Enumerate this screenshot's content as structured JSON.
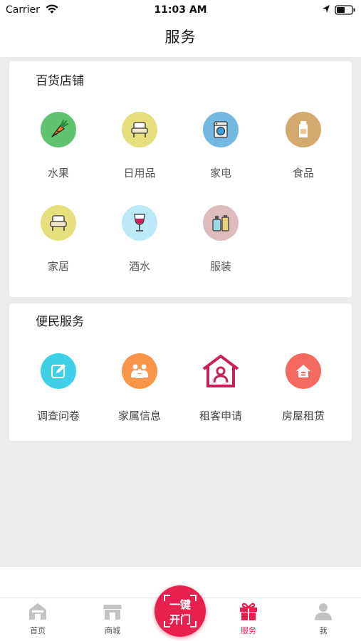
{
  "status_bar": {
    "carrier": "Carrier",
    "time": "11:03 AM"
  },
  "nav": {
    "title": "服务"
  },
  "department_store": {
    "title": "百货店铺",
    "items": [
      {
        "label": "水果",
        "icon": "carrot-icon",
        "color": "#5fc36f"
      },
      {
        "label": "日用品",
        "icon": "armchair-icon",
        "color": "#e5df7e"
      },
      {
        "label": "家电",
        "icon": "washing-machine-icon",
        "color": "#72b8e0"
      },
      {
        "label": "食品",
        "icon": "bottle-icon",
        "color": "#d4a96e"
      },
      {
        "label": "家居",
        "icon": "armchair-icon",
        "color": "#e5df7e"
      },
      {
        "label": "酒水",
        "icon": "wine-glass-icon",
        "color": "#bde9f7"
      },
      {
        "label": "服装",
        "icon": "cosmetics-icon",
        "color": "#dcbcbc"
      }
    ]
  },
  "convenience": {
    "title": "便民服务",
    "items": [
      {
        "label": "调查问卷",
        "icon": "edit-icon",
        "color": "#3fd0e7"
      },
      {
        "label": "家属信息",
        "icon": "family-icon",
        "color": "#f9954a"
      },
      {
        "label": "租客申请",
        "icon": "tenant-house-icon",
        "color": "#c8205a"
      },
      {
        "label": "房屋租赁",
        "icon": "house-icon",
        "color": "#f56a5e"
      }
    ]
  },
  "tab_bar": {
    "tabs": [
      {
        "label": "首页",
        "icon": "home-icon"
      },
      {
        "label": "商城",
        "icon": "store-icon"
      },
      {
        "label": "服务",
        "icon": "gift-icon",
        "active": true
      },
      {
        "label": "我",
        "icon": "user-icon"
      }
    ],
    "center_button": {
      "line1": "一键",
      "line2": "开门"
    }
  },
  "colors": {
    "accent": "#e8204e",
    "background": "#ececec"
  }
}
